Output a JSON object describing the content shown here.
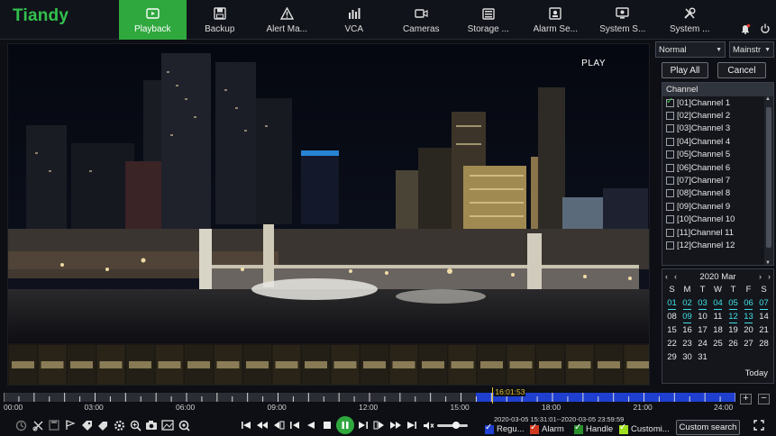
{
  "brand": "Tiandy",
  "nav": [
    {
      "label": "Playback",
      "icon": "playback-icon",
      "active": true
    },
    {
      "label": "Backup",
      "icon": "save-icon",
      "active": false
    },
    {
      "label": "Alert Ma...",
      "icon": "alert-icon",
      "active": false
    },
    {
      "label": "VCA",
      "icon": "chart-icon",
      "active": false
    },
    {
      "label": "Cameras",
      "icon": "camera-icon",
      "active": false
    },
    {
      "label": "Storage ...",
      "icon": "storage-icon",
      "active": false
    },
    {
      "label": "Alarm Se...",
      "icon": "alarm-icon",
      "active": false
    },
    {
      "label": "System S...",
      "icon": "monitor-icon",
      "active": false
    },
    {
      "label": "System ...",
      "icon": "tools-icon",
      "active": false
    }
  ],
  "video": {
    "status": "PLAY"
  },
  "panel": {
    "mode_select": "Normal",
    "stream_select": "Mainstr",
    "play_all": "Play All",
    "cancel": "Cancel",
    "channel_header": "Channel",
    "channels": [
      {
        "label": "[01]Channel 1",
        "checked": true
      },
      {
        "label": "[02]Channel 2",
        "checked": false
      },
      {
        "label": "[03]Channel 3",
        "checked": false
      },
      {
        "label": "[04]Channel 4",
        "checked": false
      },
      {
        "label": "[05]Channel 5",
        "checked": false
      },
      {
        "label": "[06]Channel 6",
        "checked": false
      },
      {
        "label": "[07]Channel 7",
        "checked": false
      },
      {
        "label": "[08]Channel 8",
        "checked": false
      },
      {
        "label": "[09]Channel 9",
        "checked": false
      },
      {
        "label": "[10]Channel 10",
        "checked": false
      },
      {
        "label": "[11]Channel 11",
        "checked": false
      },
      {
        "label": "[12]Channel 12",
        "checked": false
      }
    ]
  },
  "calendar": {
    "title": "2020 Mar",
    "weekdays": [
      "S",
      "M",
      "T",
      "W",
      "T",
      "F",
      "S"
    ],
    "days": [
      {
        "d": "01",
        "rec": true
      },
      {
        "d": "02",
        "rec": true
      },
      {
        "d": "03",
        "rec": true
      },
      {
        "d": "04",
        "rec": true
      },
      {
        "d": "05",
        "rec": true
      },
      {
        "d": "06",
        "rec": true
      },
      {
        "d": "07",
        "rec": true
      },
      {
        "d": "08",
        "rec": false
      },
      {
        "d": "09",
        "rec": true
      },
      {
        "d": "10",
        "rec": false
      },
      {
        "d": "11",
        "rec": false
      },
      {
        "d": "12",
        "rec": true
      },
      {
        "d": "13",
        "rec": true
      },
      {
        "d": "14",
        "rec": false
      },
      {
        "d": "15",
        "rec": false
      },
      {
        "d": "16",
        "rec": false
      },
      {
        "d": "17",
        "rec": false
      },
      {
        "d": "18",
        "rec": false
      },
      {
        "d": "19",
        "rec": false
      },
      {
        "d": "20",
        "rec": false
      },
      {
        "d": "21",
        "rec": false
      },
      {
        "d": "22",
        "rec": false
      },
      {
        "d": "23",
        "rec": false
      },
      {
        "d": "24",
        "rec": false
      },
      {
        "d": "25",
        "rec": false
      },
      {
        "d": "26",
        "rec": false
      },
      {
        "d": "27",
        "rec": false
      },
      {
        "d": "28",
        "rec": false
      },
      {
        "d": "29",
        "rec": false
      },
      {
        "d": "30",
        "rec": false
      },
      {
        "d": "31",
        "rec": false
      }
    ],
    "today": "Today"
  },
  "timeline": {
    "labels": [
      "00:00",
      "03:00",
      "06:00",
      "09:00",
      "12:00",
      "15:00",
      "18:00",
      "21:00",
      "24:00"
    ],
    "cursor_time": "16:01:53",
    "record_start_hours": 15.5,
    "record_end_hours": 24,
    "cursor_hours": 16.03,
    "zoom_in": "+",
    "zoom_out": "−"
  },
  "toolbar": {
    "range_text": "2020-03-05 15:31:01--2020-03-05 23:59:59",
    "volume_level": 0.62,
    "legend": [
      {
        "label": "Regu...",
        "color": "#1f3fd0"
      },
      {
        "label": "Alarm",
        "color": "#d03a1f"
      },
      {
        "label": "Handle",
        "color": "#2a8f2a"
      },
      {
        "label": "Customi...",
        "color": "#9ee01f"
      }
    ],
    "custom_search": "Custom search"
  },
  "colors": {
    "accent": "#2fa83e",
    "record": "#1f3fd0",
    "cursor": "#e6c12e",
    "calendar_rec": "#3fe0e6"
  }
}
